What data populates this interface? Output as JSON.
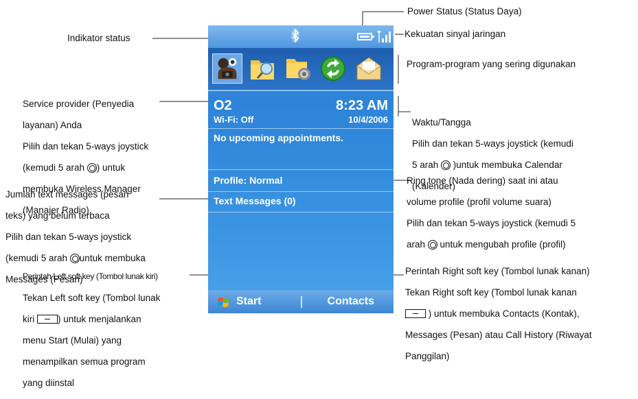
{
  "screen": {
    "carrier": "O2",
    "wifi_status": "Wi-Fi: Off",
    "time": "8:23 AM",
    "date": "10/4/2006",
    "appointments": "No upcoming appointments.",
    "profile": "Profile: Normal",
    "text_messages": "Text Messages (0)",
    "left_soft_key": "Start",
    "right_soft_key": "Contacts",
    "status_icons": [
      "bluetooth-icon",
      "battery-icon",
      "signal-strength-icon"
    ],
    "tray_icons": [
      "profile-camera-icon",
      "search-folder-icon",
      "settings-folder-icon",
      "sync-icon",
      "messaging-envelope-icon"
    ],
    "colors": {
      "screen_blue": "#2f86da",
      "tray_blue": "#1f5eaf",
      "soft_bar": "#4f97df"
    }
  },
  "annotations": {
    "power_status": "Power Status (Status Daya)",
    "signal_strength": "Kekuatan sinyal jaringan",
    "status_indicator": "Indikator status",
    "frequent_programs": "Program-program yang sering digunakan",
    "service_provider_l1": "Service provider (Penyedia",
    "service_provider_l2": "layanan) Anda",
    "service_provider_l3": "Pilih dan tekan 5-ways joystick",
    "service_provider_l4a": "(kemudi 5 arah ",
    "service_provider_l4b": ") untuk",
    "service_provider_l5": "membuka Wireless Manager",
    "service_provider_l6": "(Manajer Radio)",
    "time_date_l1": "Waktu/Tangga",
    "time_date_l2": "Pilih dan tekan 5-ways joystick (kemudi",
    "time_date_l3a": "5 arah ",
    "time_date_l3b": " )untuk membuka Calendar",
    "time_date_l4": "(Kalender)",
    "text_messages_l1": "Jumlah text messages (pesan",
    "text_messages_l2": "teks) yang belum terbaca",
    "text_messages_l3": "Pilih dan tekan 5-ways joystick",
    "text_messages_l4a": "(kemudi 5 arah ",
    "text_messages_l4b": "untuk membuka",
    "text_messages_l5": "Messages (Pesan)",
    "ring_tone_l1": "Ring tone (Nada dering) saat ini atau",
    "ring_tone_l2": "volume profile (profil volume suara)",
    "ring_tone_l3": "Pilih dan tekan 5-ways joystick (kemudi 5",
    "ring_tone_l4a": "arah ",
    "ring_tone_l4b": " untuk mengubah profile (profil)",
    "left_soft_l1": "Perintah Left soft key (Tombol lunak kiri)",
    "left_soft_l2": "Tekan Left soft key (Tombol lunak",
    "left_soft_l3a": "kiri ",
    "left_soft_l3b": ") untuk menjalankan",
    "left_soft_l4": "menu Start (Mulai) yang",
    "left_soft_l5": "menampilkan semua program",
    "left_soft_l6": "yang diinstal",
    "right_soft_l1": "Perintah Right soft key (Tombol lunak kanan)",
    "right_soft_l2": "Tekan Right soft key (Tombol lunak kanan",
    "right_soft_l3": ") untuk membuka Contacts (Kontak),",
    "right_soft_l4": "Messages (Pesan) atau Call History (Riwayat",
    "right_soft_l5": "Panggilan)"
  }
}
